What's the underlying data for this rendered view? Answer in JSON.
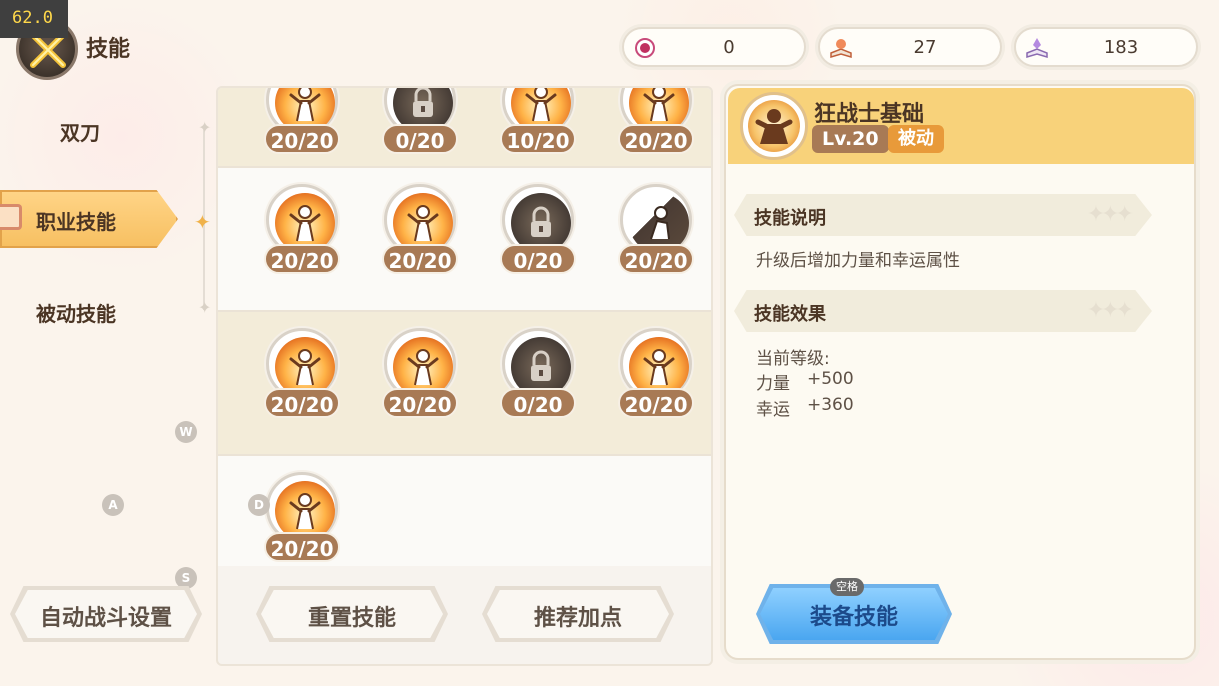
{
  "fps": "62.0",
  "header": {
    "title": "技能"
  },
  "resources": [
    {
      "icon": "orb-icon",
      "value": "0"
    },
    {
      "icon": "book-icon",
      "value": "27"
    },
    {
      "icon": "crystal-book-icon",
      "value": "183"
    }
  ],
  "menu": {
    "items": [
      {
        "label": "双刀"
      },
      {
        "label": "职业技能",
        "active": true
      },
      {
        "label": "被动技能"
      }
    ]
  },
  "key_hints": [
    "W",
    "A",
    "D",
    "S"
  ],
  "skills": [
    [
      {
        "level": "20/20",
        "style": "fire"
      },
      {
        "level": "0/20",
        "style": "dark"
      },
      {
        "level": "10/20",
        "style": "fire"
      },
      {
        "level": "20/20",
        "style": "fire"
      }
    ],
    [
      {
        "level": "20/20",
        "style": "fire"
      },
      {
        "level": "20/20",
        "style": "fire"
      },
      {
        "level": "0/20",
        "style": "dark"
      },
      {
        "level": "20/20",
        "style": "mixed"
      }
    ],
    [
      {
        "level": "20/20",
        "style": "fire"
      },
      {
        "level": "20/20",
        "style": "fire"
      },
      {
        "level": "0/20",
        "style": "dark"
      },
      {
        "level": "20/20",
        "style": "fire"
      }
    ],
    [
      {
        "level": "20/20",
        "style": "fire"
      }
    ]
  ],
  "buttons": {
    "auto_battle": "自动战斗设置",
    "reset": "重置技能",
    "recommend": "推荐加点",
    "equip": "装备技能",
    "equip_hint": "空格"
  },
  "detail": {
    "name": "狂战士基础",
    "level": "Lv.20",
    "type": "被动",
    "desc_title": "技能说明",
    "description": "升级后增加力量和幸运属性",
    "effect_title": "技能效果",
    "current_level_label": "当前等级:",
    "effects": [
      {
        "stat": "力量",
        "value": "+500"
      },
      {
        "stat": "幸运",
        "value": "+360"
      }
    ]
  },
  "colors": {
    "accent": "#f8d27a",
    "level_badge": "#a87a55",
    "type_badge": "#e89a3a",
    "equip_button": "#4aa6f0"
  }
}
